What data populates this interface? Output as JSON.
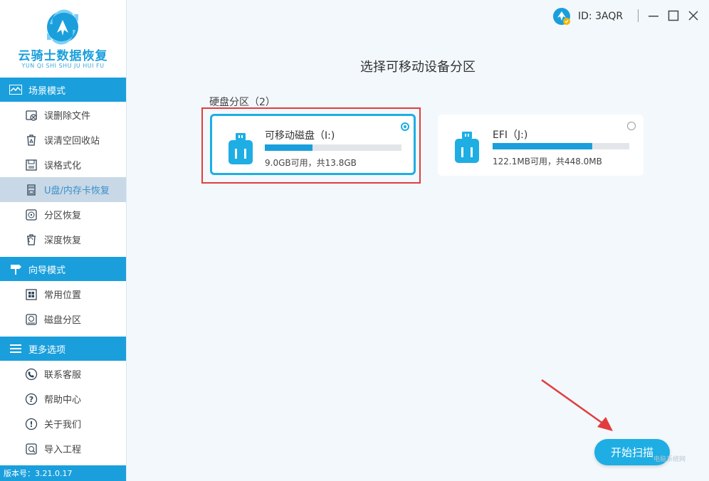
{
  "app": {
    "name": "云骑士数据恢复",
    "name_pinyin": "YUN QI SHI SHU JU HUI FU",
    "version_label": "版本号：3.21.0.17"
  },
  "colors": {
    "accent": "#1a9fdc",
    "highlight": "#e23d3d",
    "selected_border": "#1eaee3"
  },
  "topbar": {
    "user_id": "ID: 3AQR",
    "avatar_icon": "user-avatar-icon",
    "controls": [
      "menu-icon",
      "minimize-icon",
      "maximize-icon",
      "close-icon"
    ]
  },
  "sidebar": {
    "sections": [
      {
        "title": "场景模式",
        "icon": "wave-icon",
        "items": [
          {
            "label": "误删除文件",
            "icon": "deleted-file-icon",
            "active": false
          },
          {
            "label": "误清空回收站",
            "icon": "recycle-bin-icon",
            "active": false
          },
          {
            "label": "误格式化",
            "icon": "format-icon",
            "active": false
          },
          {
            "label": "U盘/内存卡恢复",
            "icon": "sd-card-icon",
            "active": true
          },
          {
            "label": "分区恢复",
            "icon": "partition-icon",
            "active": false
          },
          {
            "label": "深度恢复",
            "icon": "deep-recover-icon",
            "active": false
          }
        ]
      },
      {
        "title": "向导模式",
        "icon": "signpost-icon",
        "items": [
          {
            "label": "常用位置",
            "icon": "windows-icon",
            "active": false
          },
          {
            "label": "磁盘分区",
            "icon": "disk-icon",
            "active": false
          }
        ]
      },
      {
        "title": "更多选项",
        "icon": "menu-lines-icon",
        "items": [
          {
            "label": "联系客服",
            "icon": "phone-icon",
            "active": false
          },
          {
            "label": "帮助中心",
            "icon": "help-icon",
            "active": false
          },
          {
            "label": "关于我们",
            "icon": "info-icon",
            "active": false
          },
          {
            "label": "导入工程",
            "icon": "import-icon",
            "active": false
          }
        ]
      }
    ]
  },
  "main": {
    "title": "选择可移动设备分区",
    "partition_label": "硬盘分区（2）",
    "partitions": [
      {
        "name": "可移动磁盘（I:)",
        "info": "9.0GB可用，共13.8GB",
        "used_fraction": 0.35,
        "selected": true,
        "icon": "usb-drive-icon"
      },
      {
        "name": "EFI（J:)",
        "info": "122.1MB可用，共448.0MB",
        "used_fraction": 0.73,
        "selected": false,
        "icon": "usb-drive-icon"
      }
    ],
    "scan_button": "开始扫描"
  },
  "watermark": "电脑系统网"
}
